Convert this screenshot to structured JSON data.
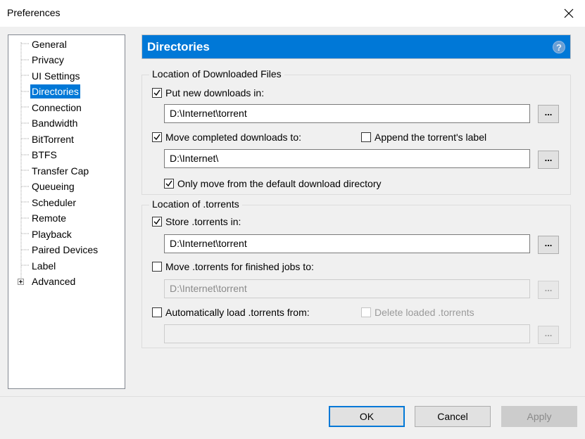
{
  "window": {
    "title": "Preferences"
  },
  "sidebar": {
    "items": [
      {
        "label": "General"
      },
      {
        "label": "Privacy"
      },
      {
        "label": "UI Settings"
      },
      {
        "label": "Directories",
        "selected": true
      },
      {
        "label": "Connection"
      },
      {
        "label": "Bandwidth"
      },
      {
        "label": "BitTorrent"
      },
      {
        "label": "BTFS"
      },
      {
        "label": "Transfer Cap"
      },
      {
        "label": "Queueing"
      },
      {
        "label": "Scheduler"
      },
      {
        "label": "Remote"
      },
      {
        "label": "Playback"
      },
      {
        "label": "Paired Devices"
      },
      {
        "label": "Label"
      },
      {
        "label": "Advanced",
        "expandable": true
      }
    ]
  },
  "panel": {
    "title": "Directories",
    "help": "?"
  },
  "downloaded": {
    "group_label": "Location of Downloaded Files",
    "put_new": {
      "label": "Put new downloads in:",
      "checked": true,
      "path": "D:\\Internet\\torrent"
    },
    "move_completed": {
      "label": "Move completed downloads to:",
      "checked": true,
      "path": "D:\\Internet\\"
    },
    "append_label": {
      "label": "Append the torrent's label",
      "checked": false
    },
    "only_move": {
      "label": "Only move from the default download directory",
      "checked": true
    }
  },
  "torrents": {
    "group_label": "Location of .torrents",
    "store": {
      "label": "Store .torrents in:",
      "checked": true,
      "path": "D:\\Internet\\torrent"
    },
    "move_finished": {
      "label": "Move .torrents for finished jobs to:",
      "checked": false,
      "path": "D:\\Internet\\torrent"
    },
    "auto_load": {
      "label": "Automatically load .torrents from:",
      "checked": false,
      "path": ""
    },
    "delete_loaded": {
      "label": "Delete loaded .torrents",
      "checked": false
    }
  },
  "browse_label": "...",
  "buttons": {
    "ok": "OK",
    "cancel": "Cancel",
    "apply": "Apply"
  },
  "colors": {
    "accent": "#0078d7",
    "window_bg": "#f0f0f0"
  }
}
